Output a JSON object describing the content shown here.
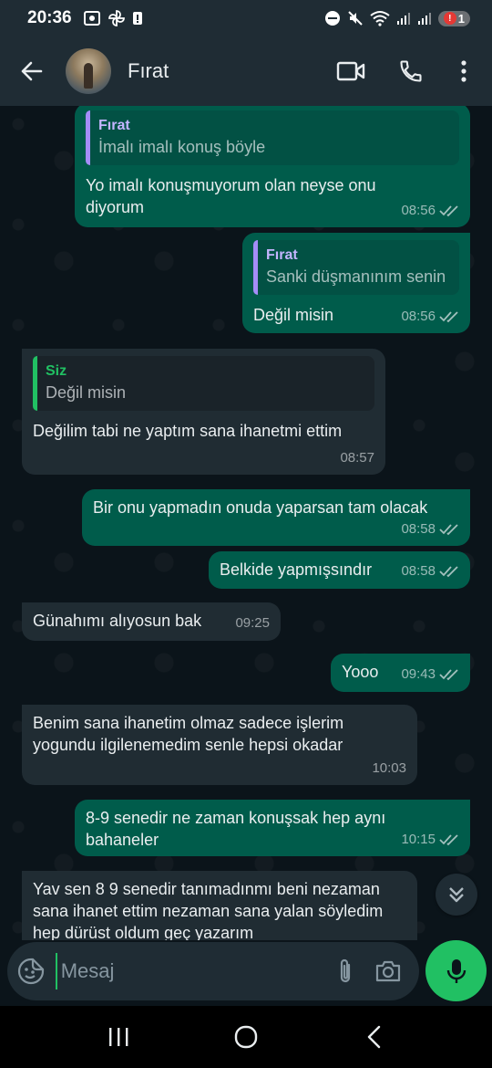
{
  "status_bar": {
    "time": "20:36",
    "notification_count": "1"
  },
  "header": {
    "contact_name": "Fırat"
  },
  "messages": [
    {
      "dir": "out",
      "quote_author": "Fırat",
      "quote_text": "İmalı imalı konuş böyle",
      "text": "Yo imalı konuşmuyorum olan neyse onu diyorum",
      "time": "08:56",
      "ticks": "read"
    },
    {
      "dir": "out",
      "quote_author": "Fırat",
      "quote_text": "Sanki düşmanınım senin",
      "text": "Değil misin",
      "time": "08:56",
      "ticks": "read"
    },
    {
      "dir": "in",
      "quote_author": "Siz",
      "quote_text": "Değil misin",
      "text": "Değilim tabi ne yaptım sana ihanetmi ettim",
      "time": "08:57"
    },
    {
      "dir": "out",
      "text": "Bir onu yapmadın onuda yaparsan tam olacak",
      "time": "08:58",
      "ticks": "read"
    },
    {
      "dir": "out",
      "text": "Belkide yapmışsındır",
      "time": "08:58",
      "ticks": "read"
    },
    {
      "dir": "in",
      "text": "Günahımı alıyosun bak",
      "time": "09:25"
    },
    {
      "dir": "out",
      "text": "Yooo",
      "time": "09:43",
      "ticks": "read"
    },
    {
      "dir": "in",
      "text": "Benim sana ihanetim olmaz sadece işlerim yogundu ilgilenemedim senle hepsi okadar",
      "time": "10:03"
    },
    {
      "dir": "out",
      "text": "8-9 senedir ne zaman konuşsak hep aynı bahaneler",
      "time": "10:15",
      "ticks": "read"
    },
    {
      "dir": "in",
      "text": "Yav sen 8 9 senedir tanımadınmı beni nezaman sana ihanet ettim nezaman sana yalan söyledim hep dürüst oldum geç yazarım"
    }
  ],
  "composer": {
    "placeholder": "Mesaj"
  },
  "colors": {
    "accent": "#21c063",
    "outgoing_bubble": "#005c4b",
    "incoming_bubble": "#202c33",
    "background": "#0b141a",
    "bar": "#1f2c34"
  }
}
